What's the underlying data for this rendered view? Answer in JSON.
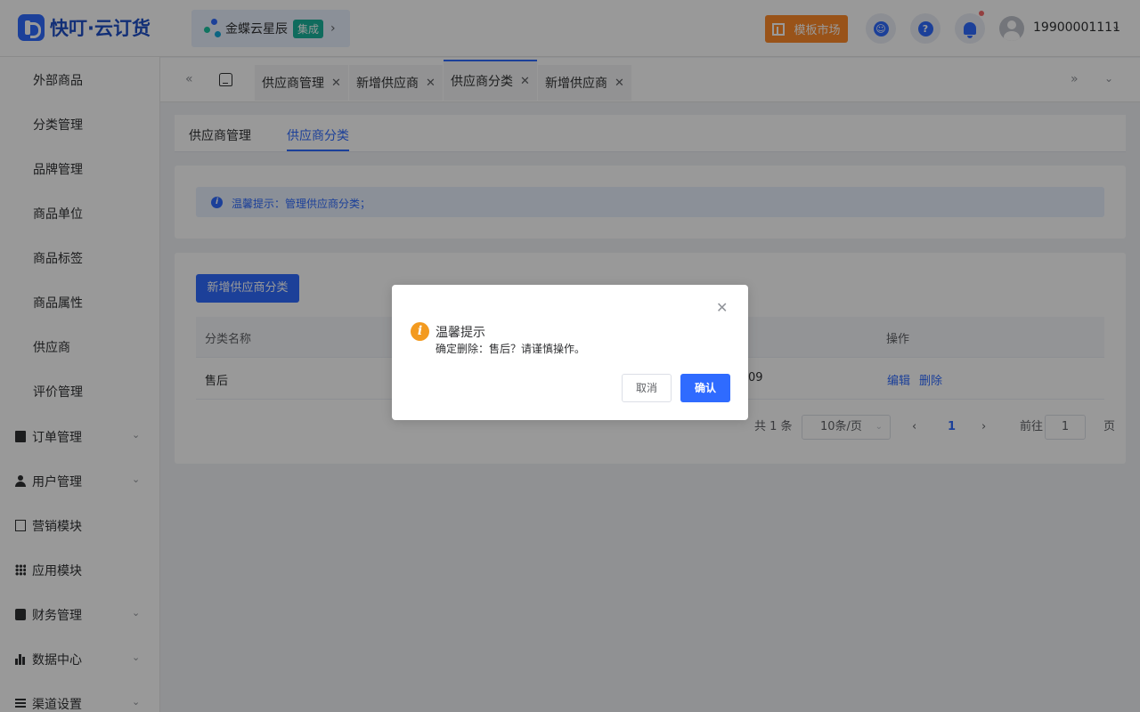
{
  "header": {
    "logo_text": "快叮·云订货",
    "org_name": "金蝶云星辰",
    "org_badge": "集成",
    "market_label": "模板市场",
    "user_phone": "19900001111"
  },
  "sidebar": {
    "sub_items": [
      "外部商品",
      "分类管理",
      "品牌管理",
      "商品单位",
      "商品标签",
      "商品属性",
      "供应商",
      "评价管理"
    ],
    "groups": [
      {
        "label": "订单管理",
        "icon": "clipboard-icon",
        "expandable": true
      },
      {
        "label": "用户管理",
        "icon": "user-icon",
        "expandable": true
      },
      {
        "label": "营销模块",
        "icon": "trend-icon",
        "expandable": false
      },
      {
        "label": "应用模块",
        "icon": "grid-icon",
        "expandable": false
      },
      {
        "label": "财务管理",
        "icon": "wallet-icon",
        "expandable": true
      },
      {
        "label": "数据中心",
        "icon": "bar-chart-icon",
        "expandable": true
      },
      {
        "label": "渠道设置",
        "icon": "list-icon",
        "expandable": true
      }
    ]
  },
  "tabs": [
    {
      "label": "供应商管理",
      "active": false
    },
    {
      "label": "新增供应商",
      "active": false
    },
    {
      "label": "供应商分类",
      "active": true
    },
    {
      "label": "新增供应商",
      "active": false
    }
  ],
  "subtabs": [
    "供应商管理",
    "供应商分类"
  ],
  "tip": {
    "text": "温馨提示：管理供应商分类；"
  },
  "main": {
    "add_button": "新增供应商分类",
    "columns": [
      "分类名称",
      "操作"
    ],
    "rows": [
      {
        "name": "售后",
        "partial_value": "09",
        "actions": [
          "编辑",
          "删除"
        ]
      }
    ]
  },
  "pagination": {
    "total": "共 1 条",
    "page_size": "10条/页",
    "current_page": "1",
    "goto_label": "前往",
    "goto_value": "1",
    "page_suffix": "页"
  },
  "dialog": {
    "title": "温馨提示",
    "message": "确定删除：售后？请谨慎操作。",
    "cancel": "取消",
    "confirm": "确认"
  },
  "colors": {
    "primary": "#2f6bff",
    "warning": "#f39a1f",
    "market": "#ff8a2a",
    "badge": "#19b39b"
  }
}
